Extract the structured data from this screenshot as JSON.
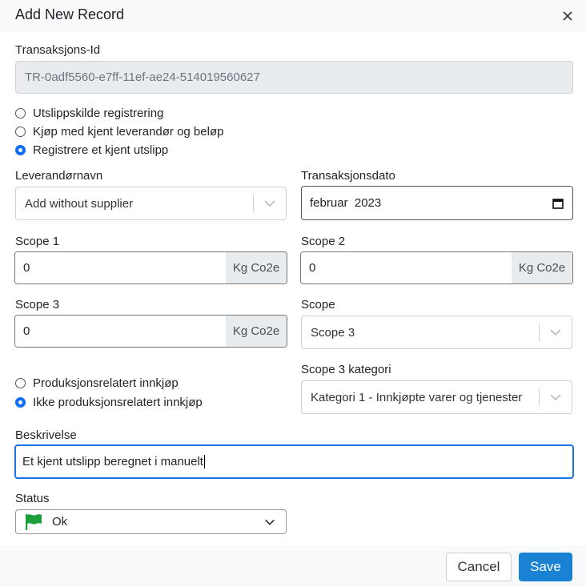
{
  "modal": {
    "title": "Add New Record"
  },
  "transaction_id": {
    "label": "Transaksjons-Id",
    "value": "TR-0adf5560-e7ff-11ef-ae24-514019560627"
  },
  "record_type": {
    "options": [
      {
        "label": "Utslippskilde registrering",
        "checked": false
      },
      {
        "label": "Kjøp med kjent leverandør og beløp",
        "checked": false
      },
      {
        "label": "Registrere et kjent utslipp",
        "checked": true
      }
    ]
  },
  "supplier": {
    "label": "Leverandørnavn",
    "value": "Add without supplier"
  },
  "transaction_date": {
    "label": "Transaksjonsdato",
    "value": "februar  2023"
  },
  "scope1": {
    "label": "Scope 1",
    "value": "0",
    "unit": "Kg Co2e"
  },
  "scope2": {
    "label": "Scope 2",
    "value": "0",
    "unit": "Kg Co2e"
  },
  "scope3": {
    "label": "Scope 3",
    "value": "0",
    "unit": "Kg Co2e"
  },
  "scope": {
    "label": "Scope",
    "value": "Scope 3"
  },
  "purchase_type": {
    "options": [
      {
        "label": "Produksjonsrelatert innkjøp",
        "checked": false
      },
      {
        "label": "Ikke produksjonsrelatert innkjøp",
        "checked": true
      }
    ]
  },
  "scope3_category": {
    "label": "Scope 3 kategori",
    "value": "Kategori 1 - Innkjøpte varer og tjenester"
  },
  "description": {
    "label": "Beskrivelse",
    "value": "Et kjent utslipp beregnet i manuelt"
  },
  "status": {
    "label": "Status",
    "value": "Ok",
    "flag_color": "#1e9e3a"
  },
  "footer": {
    "cancel_label": "Cancel",
    "save_label": "Save"
  },
  "colors": {
    "accent": "#1a82d2",
    "focus": "#1a73e8",
    "radio_checked": "#0d6efd"
  },
  "icons": {
    "close": "close-icon",
    "chevron": "chevron-down-icon",
    "calendar": "calendar-icon",
    "flag": "flag-icon"
  }
}
